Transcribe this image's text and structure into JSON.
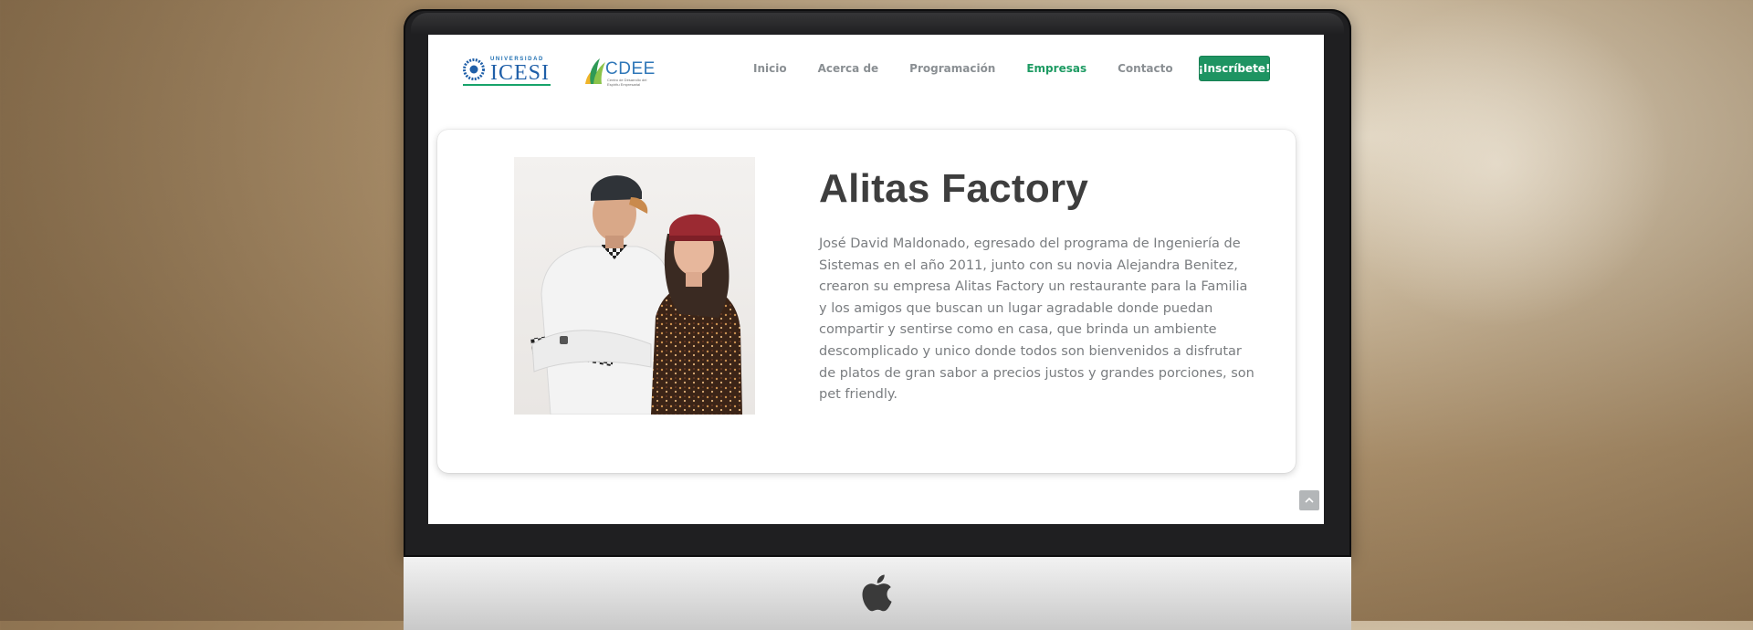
{
  "header": {
    "logo_icesi_small": "UNIVERSIDAD",
    "logo_icesi_big": "ICESI",
    "logo_cdee_big": "CDEE",
    "logo_cdee_small": "Centro de Desarrollo del Espíritu Empresarial",
    "nav": [
      {
        "label": "Inicio",
        "active": false
      },
      {
        "label": "Acerca de",
        "active": false
      },
      {
        "label": "Programación",
        "active": false
      },
      {
        "label": "Empresas",
        "active": true
      },
      {
        "label": "Contacto",
        "active": false
      }
    ],
    "cta_label": "¡Inscríbete!"
  },
  "company": {
    "title": "Alitas Factory",
    "description": "José David Maldonado, egresado del programa de Ingeniería de Sistemas en el año 2011, junto con su novia Alejandra Benitez, crearon su empresa Alitas Factory un restaurante para la Familia y los amigos que buscan un lugar agradable donde puedan compartir y sentirse como en casa, que brinda un ambiente descomplicado y unico donde todos son bienvenidos a disfrutar de platos de gran sabor a precios justos y grandes porciones, son pet friendly."
  },
  "icons": {
    "scroll_top": "chevron-up-icon",
    "apple": "apple-logo-icon"
  },
  "colors": {
    "accent_green": "#1e9462",
    "title_gray": "#3e3e3e",
    "body_gray": "#7a7d80",
    "nav_gray": "#8a8f93"
  }
}
